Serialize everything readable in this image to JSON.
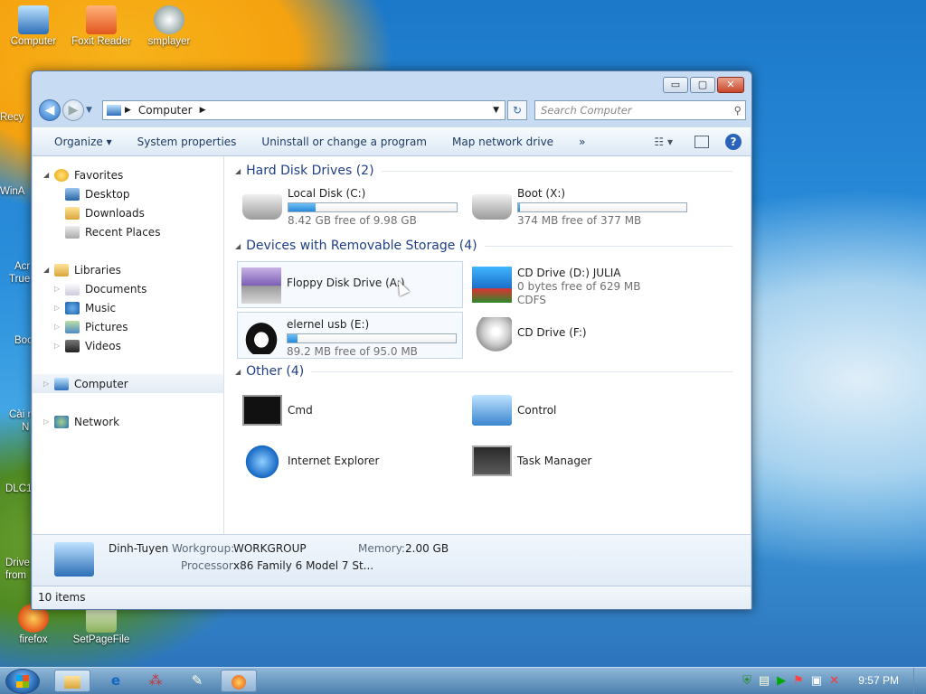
{
  "desktop": {
    "icons": [
      {
        "label": "Computer"
      },
      {
        "label": "Foxit Reader"
      },
      {
        "label": "smplayer"
      },
      {
        "label": "firefox"
      },
      {
        "label": "SetPageFile"
      }
    ],
    "left_stubs": [
      "Recy",
      "WinA",
      "Acr",
      "True",
      "Boo",
      "Cài n",
      "N",
      "DLC1",
      "Drive",
      "from"
    ]
  },
  "window": {
    "controls": {
      "min": "▭",
      "max": "▢",
      "close": "✕"
    },
    "address": {
      "crumb": "Computer"
    },
    "search": {
      "placeholder": "Search Computer"
    },
    "toolbar": {
      "organize": "Organize ▾",
      "system_properties": "System properties",
      "uninstall": "Uninstall or change a program",
      "map_drive": "Map network drive",
      "more": "»"
    },
    "nav": {
      "favorites": "Favorites",
      "desktop": "Desktop",
      "downloads": "Downloads",
      "recent": "Recent Places",
      "libraries": "Libraries",
      "documents": "Documents",
      "music": "Music",
      "pictures": "Pictures",
      "videos": "Videos",
      "computer": "Computer",
      "network": "Network"
    },
    "groups": {
      "hdd": "Hard Disk Drives (2)",
      "removable": "Devices with Removable Storage (4)",
      "other": "Other (4)"
    },
    "drives": {
      "c": {
        "name": "Local Disk (C:)",
        "free": "8.42 GB free of 9.98 GB",
        "used_fraction": 0.16
      },
      "x": {
        "name": "Boot (X:)",
        "free": "374 MB free of 377 MB",
        "used_fraction": 0.01
      },
      "a": {
        "name": "Floppy Disk Drive (A:)"
      },
      "d": {
        "name": "CD Drive (D:) JULIA",
        "free": "0 bytes free of 629 MB",
        "fs": "CDFS"
      },
      "e": {
        "name": "elernel usb (E:)",
        "free": "89.2 MB free of 95.0 MB",
        "used_fraction": 0.06
      },
      "f": {
        "name": "CD Drive (F:)"
      }
    },
    "other": {
      "cmd": "Cmd",
      "control": "Control",
      "ie": "Internet Explorer",
      "taskmgr": "Task Manager"
    },
    "details": {
      "pc_name": "Dinh-Tuyen",
      "workgroup_label": "Workgroup:",
      "workgroup": "WORKGROUP",
      "memory_label": "Memory:",
      "memory": "2.00 GB",
      "processor_label": "Processor:",
      "processor": "x86 Family 6 Model 7 St..."
    },
    "status": "10 items"
  },
  "taskbar": {
    "clock": "9:57 PM"
  }
}
